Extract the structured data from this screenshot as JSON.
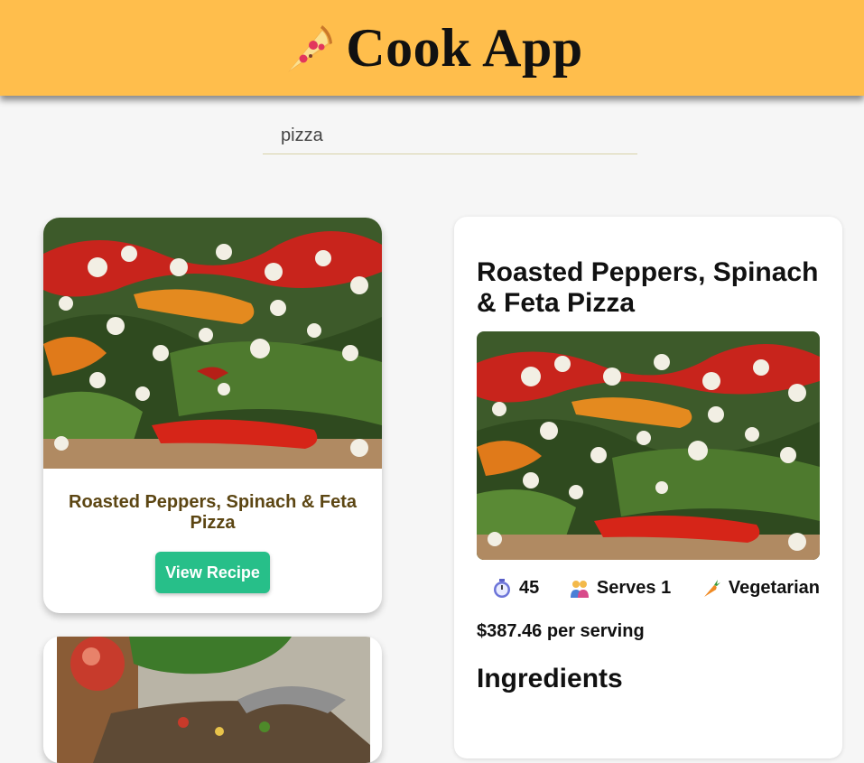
{
  "header": {
    "title": "Cook App",
    "logo_icon": "pizza-icon",
    "background": "#ffbe4c"
  },
  "search": {
    "value": "pizza"
  },
  "results": [
    {
      "title": "Roasted Peppers, Spinach & Feta Pizza",
      "button_label": "View Recipe",
      "image_icon": "pizza-photo"
    },
    {
      "image_icon": "pizza-salad-photo"
    }
  ],
  "detail": {
    "title": "Roasted Peppers, Spinach & Feta Pizza",
    "image_icon": "pizza-photo",
    "time": "45",
    "time_icon": "stopwatch-icon",
    "serves": "Serves 1",
    "serves_icon": "people-icon",
    "diet": "Vegetarian",
    "diet_icon": "carrot-icon",
    "price": "$387.46 per serving",
    "ingredients_heading": "Ingredients"
  },
  "colors": {
    "accent": "#27bf89",
    "card_title": "#5c4613"
  }
}
